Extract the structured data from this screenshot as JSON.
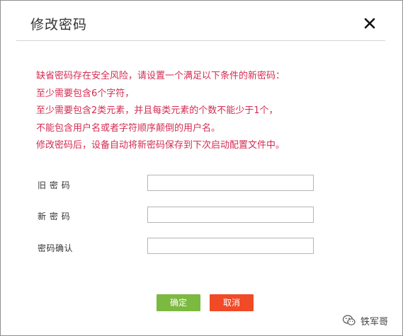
{
  "dialog": {
    "title": "修改密码",
    "close_icon": "close-icon"
  },
  "notice": {
    "color": "#d42c52",
    "lines": [
      "缺省密码存在安全风险，请设置一个满足以下条件的新密码：",
      "至少需要包含6个字符，",
      "至少需要包含2类元素，并且每类元素的个数不能少于1个，",
      "不能包含用户名或者字符顺序颠倒的用户名。",
      "修改密码后，设备自动将新密码保存到下次启动配置文件中。"
    ]
  },
  "form": {
    "old_password": {
      "label": "旧 密 码",
      "value": ""
    },
    "new_password": {
      "label": "新 密 码",
      "value": ""
    },
    "confirm_password": {
      "label": "密码确认",
      "value": ""
    }
  },
  "buttons": {
    "ok_label": "确定",
    "ok_color": "#7cb940",
    "cancel_label": "取消",
    "cancel_color": "#f04a27"
  },
  "watermark": {
    "icon": "wechat-icon",
    "text": "铁军哥"
  }
}
